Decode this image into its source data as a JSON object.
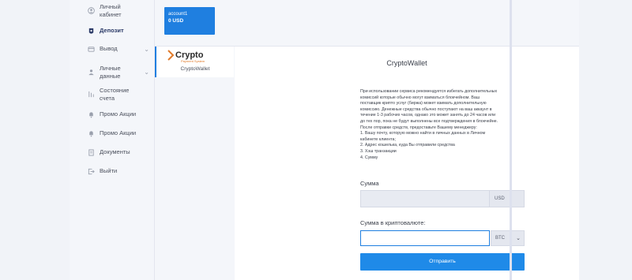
{
  "sidebar": {
    "items": [
      {
        "label": "Личный кабинет",
        "icon": "user-icon"
      },
      {
        "label": "Депозит",
        "icon": "deposit-icon",
        "active": true
      },
      {
        "label": "Вывод",
        "icon": "withdraw-icon",
        "has_submenu": true
      },
      {
        "label": "Личные данные",
        "icon": "profile-icon",
        "has_submenu": true
      },
      {
        "label": "Состояние счета",
        "icon": "balance-icon"
      },
      {
        "label": "Промо Акции",
        "icon": "bell-icon"
      },
      {
        "label": "Промо Акции",
        "icon": "bell-icon"
      },
      {
        "label": "Документы",
        "icon": "document-icon"
      },
      {
        "label": "Выйти",
        "icon": "logout-icon"
      }
    ]
  },
  "account": {
    "name": "account1",
    "balance": "0 USD"
  },
  "provider": {
    "logo_text": "Crypto",
    "logo_subtext": "Payment System",
    "name": "CryptoWallet"
  },
  "content": {
    "title": "CryptoWallet",
    "info_lines": [
      "При использовании сервиса рекомендуется избегать дополнительных",
      "комиссий которые обычно могут взиматься блокчейном. Ваш",
      "поставщик крипто услуг (биржа) может взимать дополнительную",
      "комиссию. Денежные средства обычно поступают на ваш аккаунт в",
      "течение 1-3 рабочих часов, однако это может занять до 24 часов или",
      "до тех пор, пока не будут выполнены все подтверждения в блокчейне.",
      "После отправки средств, предоставьте Вашему менеджеру:",
      "1. Вашу почту, которую можно найти в личных данных в Личном",
      "кабинете клиента;",
      "2. Адрес кошелька, куда Вы отправили средства",
      "3. Хэш транзакции",
      "4. Сумму"
    ],
    "amount_label": "Сумма",
    "amount_value": "",
    "amount_currency": "USD",
    "crypto_label": "Сумма в криптовалюте:",
    "crypto_value": "",
    "crypto_currency": "BTC",
    "submit_label": "Отправить"
  },
  "colors": {
    "accent": "#1f7fe0",
    "active_nav": "#2b3a67"
  }
}
